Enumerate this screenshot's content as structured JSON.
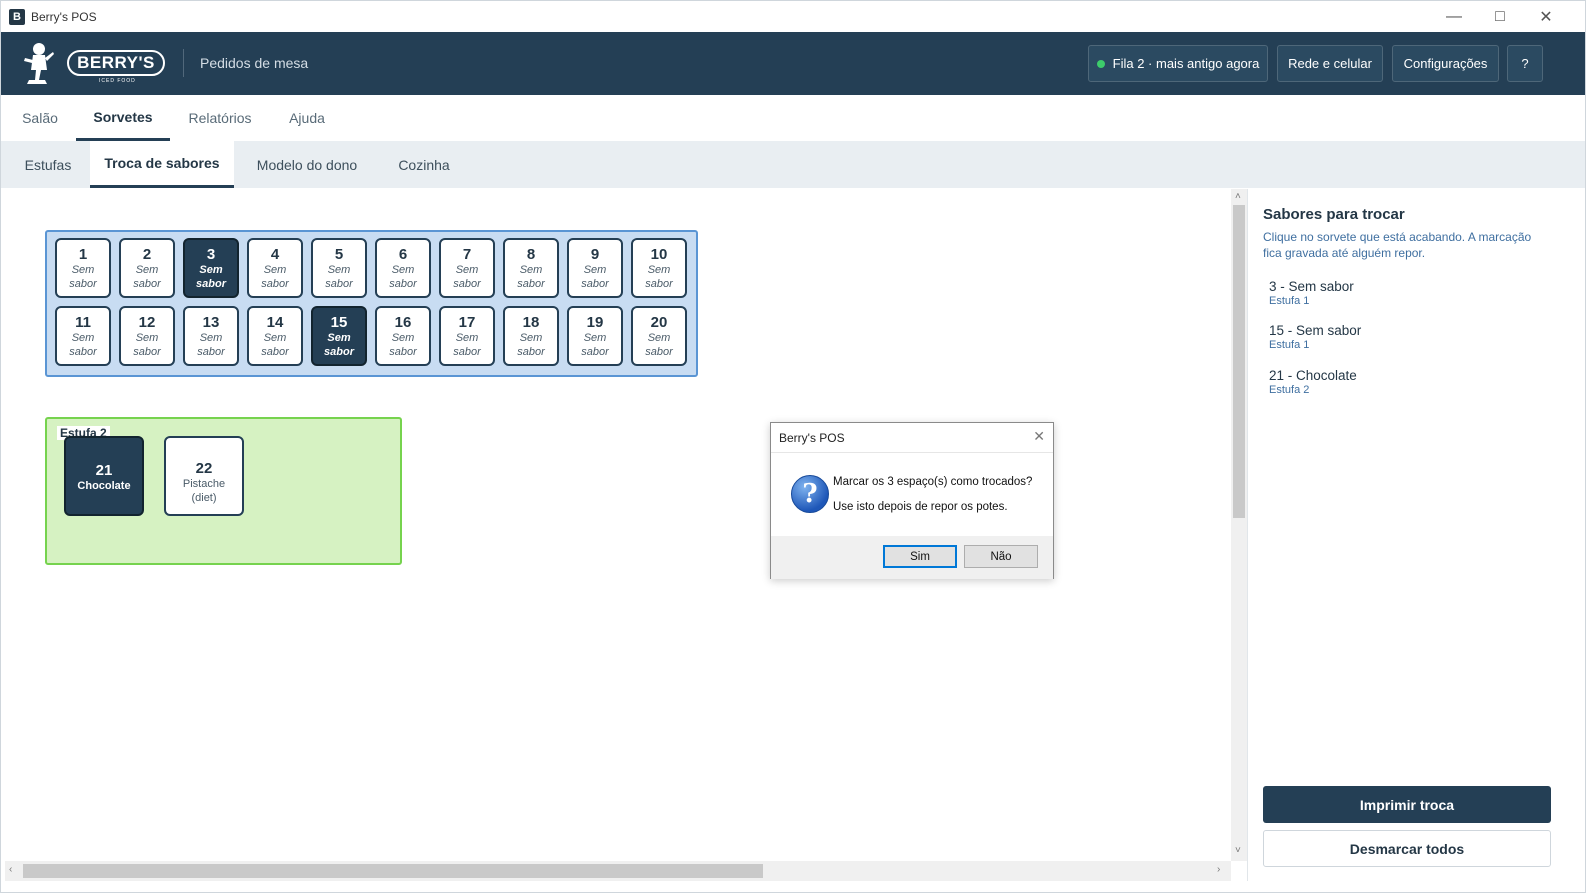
{
  "window": {
    "title": "Berry's POS",
    "icon_letter": "𝘽"
  },
  "header": {
    "brand": "BERRY'S",
    "brand_sub": "ICED FOOD",
    "subtitle": "Pedidos de mesa",
    "status_button": "Fila 2 · mais antigo agora",
    "network_button": "Rede e celular",
    "settings_button": "Configurações",
    "help_button": "?"
  },
  "tabs_main": [
    "Salão",
    "Sorvetes",
    "Relatórios",
    "Ajuda"
  ],
  "tabs_sub": [
    "Estufas",
    "Troca de sabores",
    "Modelo do dono",
    "Cozinha"
  ],
  "estufa1": {
    "slots": [
      {
        "num": "1",
        "l1": "Sem",
        "l2": "sabor",
        "selected": false
      },
      {
        "num": "2",
        "l1": "Sem",
        "l2": "sabor",
        "selected": false
      },
      {
        "num": "3",
        "l1": "Sem",
        "l2": "sabor",
        "selected": true
      },
      {
        "num": "4",
        "l1": "Sem",
        "l2": "sabor",
        "selected": false
      },
      {
        "num": "5",
        "l1": "Sem",
        "l2": "sabor",
        "selected": false
      },
      {
        "num": "6",
        "l1": "Sem",
        "l2": "sabor",
        "selected": false
      },
      {
        "num": "7",
        "l1": "Sem",
        "l2": "sabor",
        "selected": false
      },
      {
        "num": "8",
        "l1": "Sem",
        "l2": "sabor",
        "selected": false
      },
      {
        "num": "9",
        "l1": "Sem",
        "l2": "sabor",
        "selected": false
      },
      {
        "num": "10",
        "l1": "Sem",
        "l2": "sabor",
        "selected": false
      },
      {
        "num": "11",
        "l1": "Sem",
        "l2": "sabor",
        "selected": false
      },
      {
        "num": "12",
        "l1": "Sem",
        "l2": "sabor",
        "selected": false
      },
      {
        "num": "13",
        "l1": "Sem",
        "l2": "sabor",
        "selected": false
      },
      {
        "num": "14",
        "l1": "Sem",
        "l2": "sabor",
        "selected": false
      },
      {
        "num": "15",
        "l1": "Sem",
        "l2": "sabor",
        "selected": true
      },
      {
        "num": "16",
        "l1": "Sem",
        "l2": "sabor",
        "selected": false
      },
      {
        "num": "17",
        "l1": "Sem",
        "l2": "sabor",
        "selected": false
      },
      {
        "num": "18",
        "l1": "Sem",
        "l2": "sabor",
        "selected": false
      },
      {
        "num": "19",
        "l1": "Sem",
        "l2": "sabor",
        "selected": false
      },
      {
        "num": "20",
        "l1": "Sem",
        "l2": "sabor",
        "selected": false
      }
    ]
  },
  "estufa2": {
    "label": "Estufa 2",
    "slots": [
      {
        "num": "21",
        "l1": "Chocolate",
        "l2": "",
        "selected": true
      },
      {
        "num": "22",
        "l1": "Pistache",
        "l2": "(diet)",
        "selected": false
      }
    ]
  },
  "panel": {
    "title": "Sabores para trocar",
    "help": "Clique no sorvete que está acabando. A marcação fica gravada até alguém repor.",
    "items": [
      {
        "name": "3 - Sem sabor",
        "estufa": "Estufa 1"
      },
      {
        "name": "15 - Sem sabor",
        "estufa": "Estufa 1"
      },
      {
        "name": "21 - Chocolate",
        "estufa": "Estufa 2"
      }
    ],
    "print_button": "Imprimir troca",
    "clear_button": "Desmarcar todos"
  },
  "dialog": {
    "title": "Berry's POS",
    "line1": "Marcar os 3 espaço(s) como trocados?",
    "line2": "Use isto depois de repor os potes.",
    "yes": "Sim",
    "no": "Não"
  },
  "colors": {
    "navy": "#243f55",
    "estufa1_bg": "#c8dcf2",
    "estufa2_bg": "#d6f2c2",
    "status_dot": "#3dcc6b"
  }
}
